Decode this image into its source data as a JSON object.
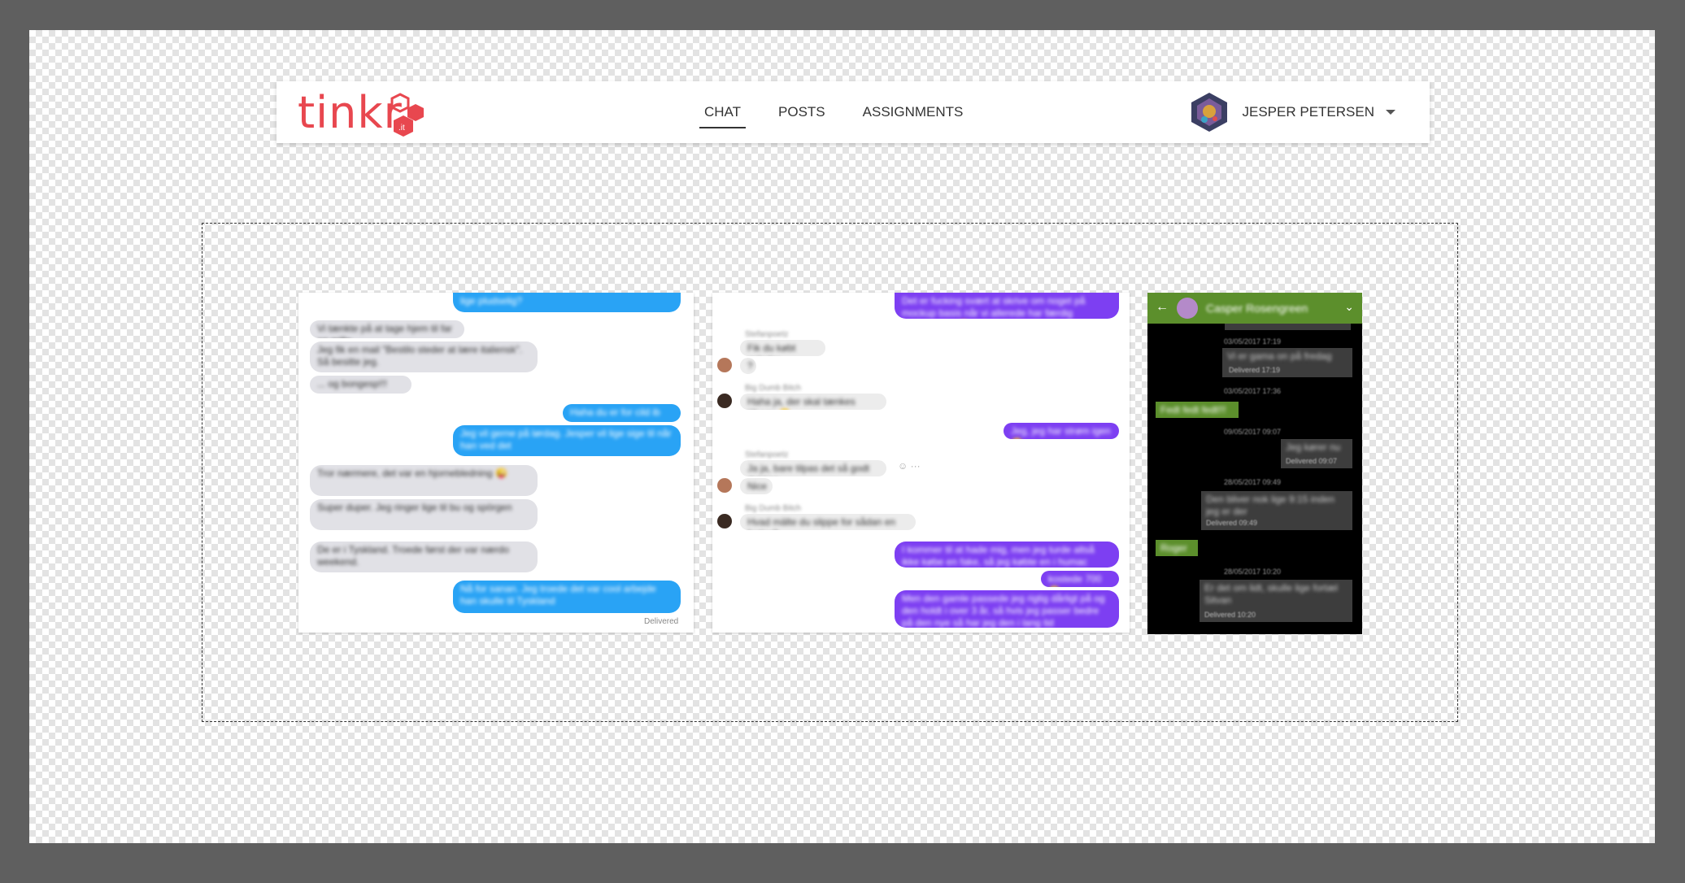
{
  "logo": {
    "text": "tinkr",
    "badge": ".it"
  },
  "nav": {
    "links": [
      {
        "label": "CHAT",
        "active": true
      },
      {
        "label": "POSTS",
        "active": false
      },
      {
        "label": "ASSIGNMENTS",
        "active": false
      }
    ]
  },
  "user": {
    "name": "JESPER PETERSEN"
  },
  "shot1": {
    "status": "Delivered",
    "messages": [
      {
        "dir": "out",
        "text": "lige pludselig?"
      },
      {
        "dir": "in",
        "text": "Vi tænkte på at tage hjem til far og grille"
      },
      {
        "dir": "in",
        "text": "Jeg fik en mail \"Bestilo steder at lære italiensk\". Så besitte jeg."
      },
      {
        "dir": "in",
        "text": "... og bongesp!!!"
      },
      {
        "dir": "out",
        "text": "Haha du er for cild ib"
      },
      {
        "dir": "out",
        "text": "Jeg vil gerne på lørdag. Jesper vil lige sige til når han ved det"
      },
      {
        "dir": "in",
        "text": "Tror nærmere, det var en hjornebledning 😜"
      },
      {
        "dir": "in",
        "text": "Super duper. Jeg ringer lige til bu og spörgen"
      },
      {
        "dir": "in",
        "text": "De er i Tyskland. Troede først der var nærdo weekend."
      },
      {
        "dir": "out",
        "text": "Nå for sanan. Jeg troede det var cool arbejde han skulle til Tyskland"
      }
    ]
  },
  "shot2": {
    "messages": [
      {
        "dir": "out",
        "text": "Det er fucking svært at skrive om noget på mockup basis når vi allerede har færdig designet det 😂"
      },
      {
        "dir": "in",
        "sender": "Stefanpoetz",
        "text": "Fik du købt oplader"
      },
      {
        "dir": "in",
        "text": "?"
      },
      {
        "dir": "in",
        "sender": "Big Dumb Bitch",
        "text": "Haha ja, der skal tænkes tilbage 😊"
      },
      {
        "dir": "out",
        "text": "Jeg, jeg har strøm igen 😊"
      },
      {
        "dir": "in",
        "sender": "Stefanpoetz",
        "text": "Ja ja, bare tilpas det så godt det kan"
      },
      {
        "dir": "in",
        "text": "Nice"
      },
      {
        "dir": "in",
        "sender": "Big Dumb Bitch",
        "text": "Hvad mälte du slippe for sådan en fætter?"
      },
      {
        "dir": "out",
        "text": "I kommer til at hade mig, men jeg turde altså ikke købe en fake, så jeg købte en i humac"
      },
      {
        "dir": "out",
        "text": "kostede 700 😊"
      },
      {
        "dir": "out",
        "text": "Men den gamle passede jeg rigtig dårligt på og den holdt i over 3 år, så hvis jeg passer bedre på den nye så har jeg den i lang tid"
      }
    ]
  },
  "shot3": {
    "contact": "Casper Rosengreen",
    "items": [
      {
        "kind": "ts",
        "text": "03/05/2017 17:19"
      },
      {
        "kind": "out",
        "text": "Vi er gama on på fredag",
        "status": "Delivered 17:19"
      },
      {
        "kind": "ts",
        "text": "03/05/2017 17:36"
      },
      {
        "kind": "in",
        "text": "Fedt fedt fedt!!!"
      },
      {
        "kind": "ts",
        "text": "09/05/2017 09:07"
      },
      {
        "kind": "out",
        "text": "Jeg kører nu",
        "status": "Delivered 09:07"
      },
      {
        "kind": "ts",
        "text": "28/05/2017 09:49"
      },
      {
        "kind": "out",
        "text": "Den bliver nok lige 9:15 inden jeg er der",
        "status": "Delivered 09:49"
      },
      {
        "kind": "in",
        "text": "Roger"
      },
      {
        "kind": "ts",
        "text": "28/05/2017 10:20"
      },
      {
        "kind": "out",
        "text": "Er det om lidt, skulle lige fortæl Sitvan",
        "status": "Delivered 10:20"
      }
    ]
  },
  "colors": {
    "brand": "#e8474f",
    "imessage_blue": "#29a3f5",
    "messenger_purple": "#7d3ff2",
    "android_green": "#5c8f2c"
  },
  "icons": [
    "hexagon-logo-icon",
    "user-avatar-icon",
    "caret-down-icon",
    "back-arrow-icon",
    "chevron-down-icon",
    "emoji-icon",
    "more-icon"
  ]
}
